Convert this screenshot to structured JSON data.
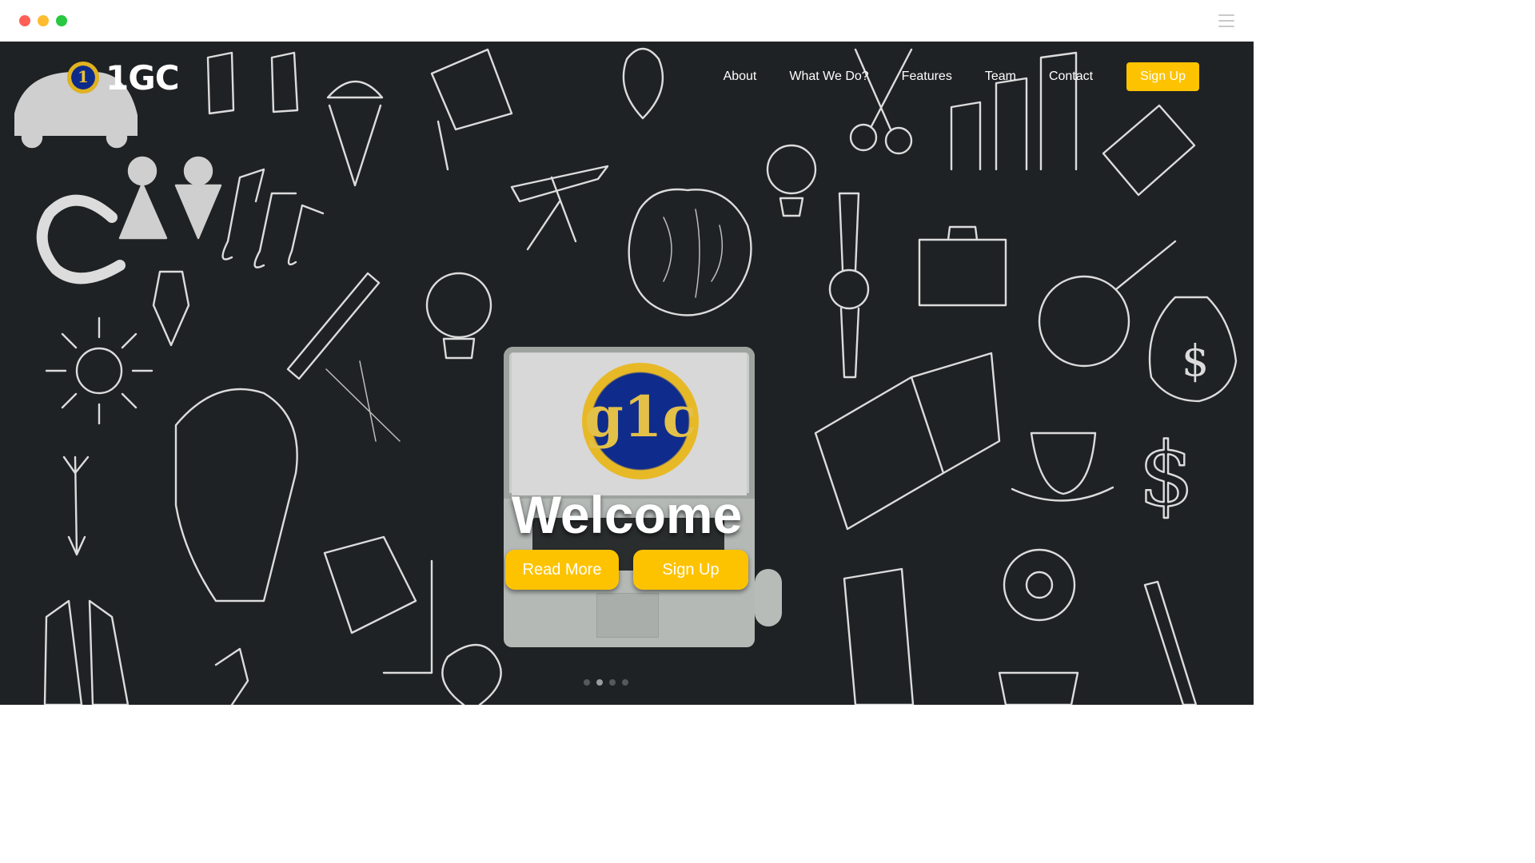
{
  "brand": {
    "name": "1GC"
  },
  "nav": {
    "items": [
      "About",
      "What We Do?",
      "Features",
      "Team",
      "Contact"
    ],
    "signup_label": "Sign Up"
  },
  "hero": {
    "title": "Welcome",
    "read_more_label": "Read More",
    "signup_label": "Sign Up",
    "emblem_text": "g1c",
    "slides": {
      "count": 4,
      "active": 2
    }
  },
  "colors": {
    "accent": "#fec300",
    "background": "#1f2224",
    "text": "#ffffff"
  }
}
